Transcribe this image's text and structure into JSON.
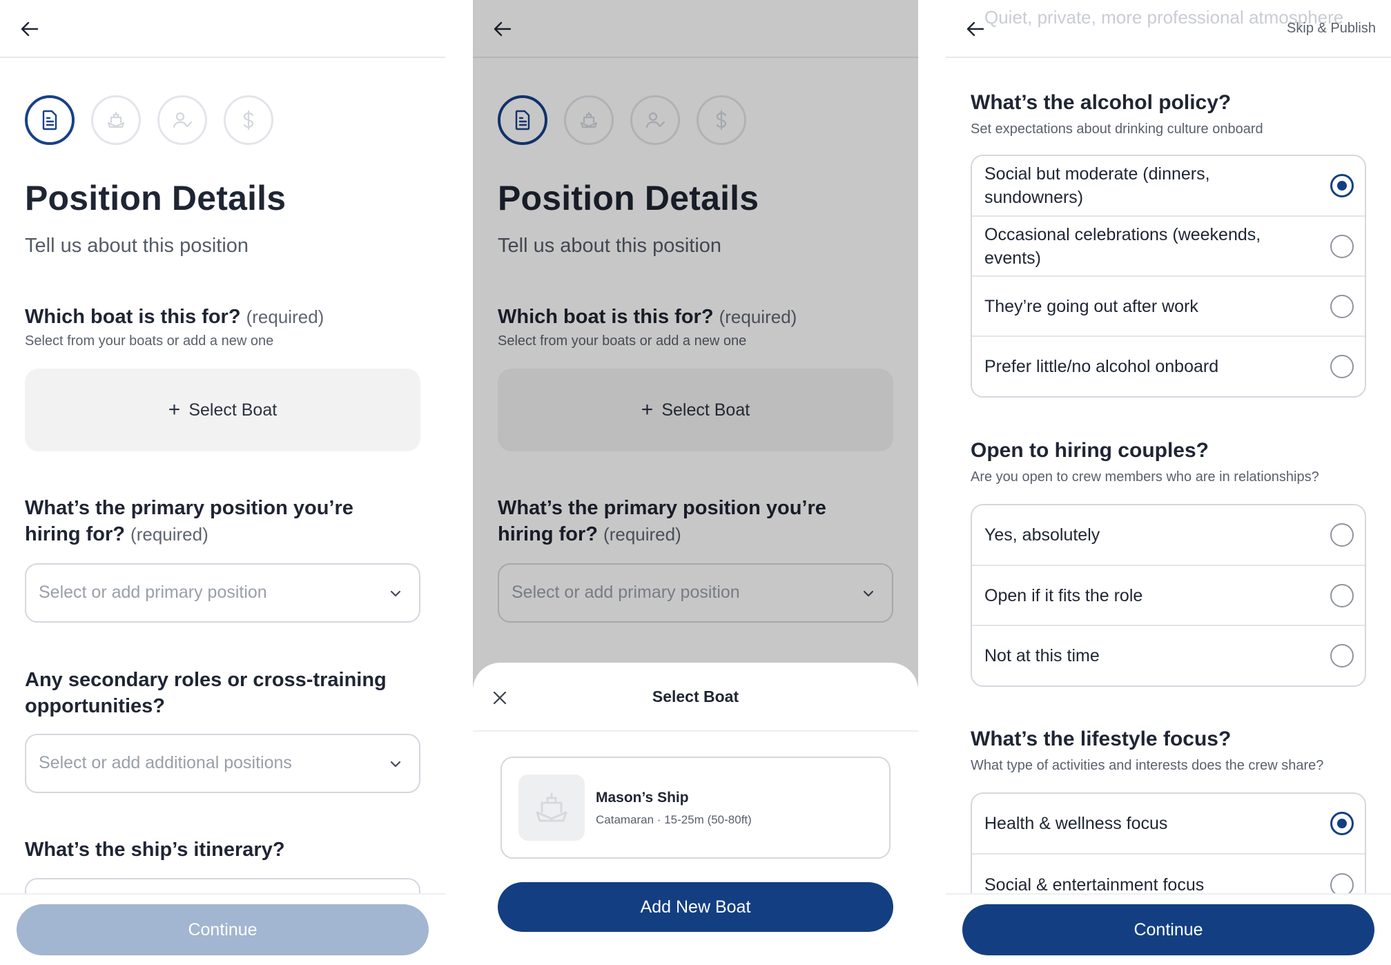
{
  "screen1": {
    "title": "Position Details",
    "subtitle": "Tell us about this position",
    "boat_question": "Which boat is this for?",
    "required_label": "(required)",
    "boat_hint": "Select from your boats or add a new one",
    "select_boat_label": "Select Boat",
    "primary_question": "What’s the primary position you’re hiring for?",
    "primary_placeholder": "Select or add primary position",
    "secondary_question": "Any secondary roles or cross-training opportunities?",
    "secondary_placeholder": "Select or add additional positions",
    "itinerary_question": "What’s the ship’s itinerary?",
    "continue_label": "Continue"
  },
  "screen2": {
    "title": "Position Details",
    "subtitle": "Tell us about this position",
    "boat_question": "Which boat is this for?",
    "required_label": "(required)",
    "boat_hint": "Select from your boats or add a new one",
    "select_boat_label": "Select Boat",
    "primary_question": "What’s the primary position you’re hiring for?",
    "primary_placeholder": "Select or add primary position",
    "sheet": {
      "title": "Select Boat",
      "boats": [
        {
          "name": "Mason’s Ship",
          "meta": "Catamaran · 15-25m (50-80ft)"
        }
      ],
      "add_label": "Add New Boat"
    }
  },
  "screen3": {
    "ghost_text": "Quiet, private, more professional atmosphere",
    "skip_label": "Skip & Publish",
    "alcohol": {
      "title": "What’s the alcohol policy?",
      "hint": "Set expectations about drinking culture onboard",
      "options": [
        {
          "label": "Social but moderate (dinners, sundowners)",
          "selected": true
        },
        {
          "label": "Occasional celebrations (weekends, events)",
          "selected": false
        },
        {
          "label": "They’re going out after work",
          "selected": false
        },
        {
          "label": "Prefer little/no alcohol onboard",
          "selected": false
        }
      ]
    },
    "couples": {
      "title": "Open to hiring couples?",
      "hint": "Are you open to crew members who are in relationships?",
      "options": [
        {
          "label": "Yes, absolutely",
          "selected": false
        },
        {
          "label": "Open if it fits the role",
          "selected": false
        },
        {
          "label": "Not at this time",
          "selected": false
        }
      ]
    },
    "lifestyle": {
      "title": "What’s the lifestyle focus?",
      "hint": "What type of activities and interests does the crew share?",
      "options": [
        {
          "label": "Health & wellness focus",
          "selected": true
        },
        {
          "label": "Social & entertainment focus",
          "selected": false
        }
      ]
    },
    "continue_label": "Continue"
  },
  "colors": {
    "primary": "#133f82",
    "disabled": "#a2b5d1",
    "text": "#1f2533"
  },
  "icons": [
    "back-arrow-icon",
    "document-icon",
    "ship-icon",
    "user-check-icon",
    "dollar-icon",
    "chevron-down-icon",
    "close-icon",
    "plus-icon"
  ]
}
